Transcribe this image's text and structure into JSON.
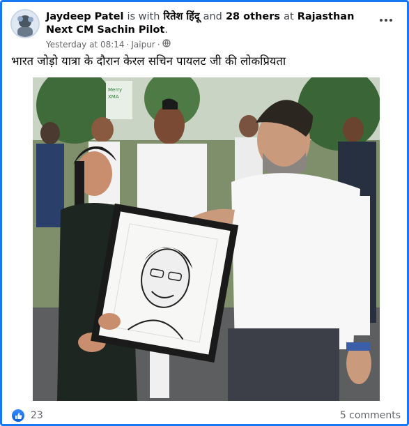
{
  "post": {
    "author": "Jaydeep Patel",
    "with_word": "is with",
    "tagged_person": "रितेश हिंदू",
    "and_word": "and",
    "others": "28 others",
    "at_word": "at",
    "location_page": "Rajasthan Next CM Sachin Pilot",
    "period": ".",
    "time": "Yesterday at 08:14",
    "separator": "·",
    "place": "Jaipur",
    "separator2": "·",
    "caption": "भारत जोड़ो यात्रा के दौरान केरल सचिन पायलट जी की लोकप्रियता"
  },
  "photo": {
    "banner_text": "Merry\nXMA"
  },
  "footer": {
    "like_count": "23",
    "comments_label": "5 comments"
  },
  "colors": {
    "accent": "#1877f2",
    "meta_text": "#65676b"
  }
}
